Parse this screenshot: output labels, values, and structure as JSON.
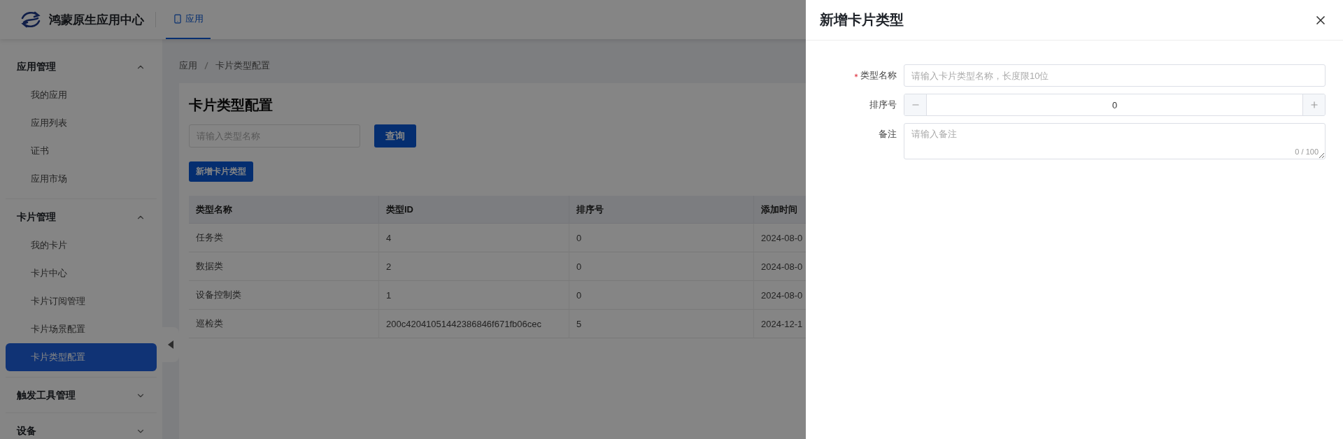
{
  "header": {
    "brand": "鸿蒙原生应用中心",
    "nav": [
      {
        "label": "应用",
        "selected": true
      }
    ]
  },
  "sidebar": {
    "groups": [
      {
        "title": "应用管理",
        "expanded": true,
        "items": [
          {
            "label": "我的应用",
            "selected": false
          },
          {
            "label": "应用列表",
            "selected": false
          },
          {
            "label": "证书",
            "selected": false
          },
          {
            "label": "应用市场",
            "selected": false
          }
        ]
      },
      {
        "title": "卡片管理",
        "expanded": true,
        "items": [
          {
            "label": "我的卡片",
            "selected": false
          },
          {
            "label": "卡片中心",
            "selected": false
          },
          {
            "label": "卡片订阅管理",
            "selected": false
          },
          {
            "label": "卡片场景配置",
            "selected": false
          },
          {
            "label": "卡片类型配置",
            "selected": true
          }
        ]
      },
      {
        "title": "触发工具管理",
        "expanded": false
      },
      {
        "title": "设备",
        "expanded": false
      }
    ]
  },
  "breadcrumb": [
    "应用",
    "卡片类型配置"
  ],
  "page": {
    "title": "卡片类型配置",
    "search": {
      "placeholder": "请输入类型名称"
    },
    "query_button": "查询",
    "add_button": "新增卡片类型"
  },
  "table": {
    "columns": [
      "类型名称",
      "类型ID",
      "排序号",
      "添加时间"
    ],
    "rows": [
      [
        "任务类",
        "4",
        "0",
        "2024-08-0"
      ],
      [
        "数据类",
        "2",
        "0",
        "2024-08-0"
      ],
      [
        "设备控制类",
        "1",
        "0",
        "2024-08-0"
      ],
      [
        "巡检类",
        "200c42041051442386846f671fb06cec",
        "5",
        "2024-12-1"
      ]
    ]
  },
  "drawer": {
    "title": "新增卡片类型",
    "fields": [
      {
        "kind": "text",
        "label": "类型名称",
        "required": true,
        "placeholder": "请输入卡片类型名称，长度限10位"
      },
      {
        "kind": "stepper",
        "label": "排序号",
        "required": false,
        "value": "0"
      },
      {
        "kind": "textarea",
        "label": "备注",
        "required": false,
        "placeholder": "请输入备注",
        "counter": "0 / 100"
      }
    ]
  }
}
